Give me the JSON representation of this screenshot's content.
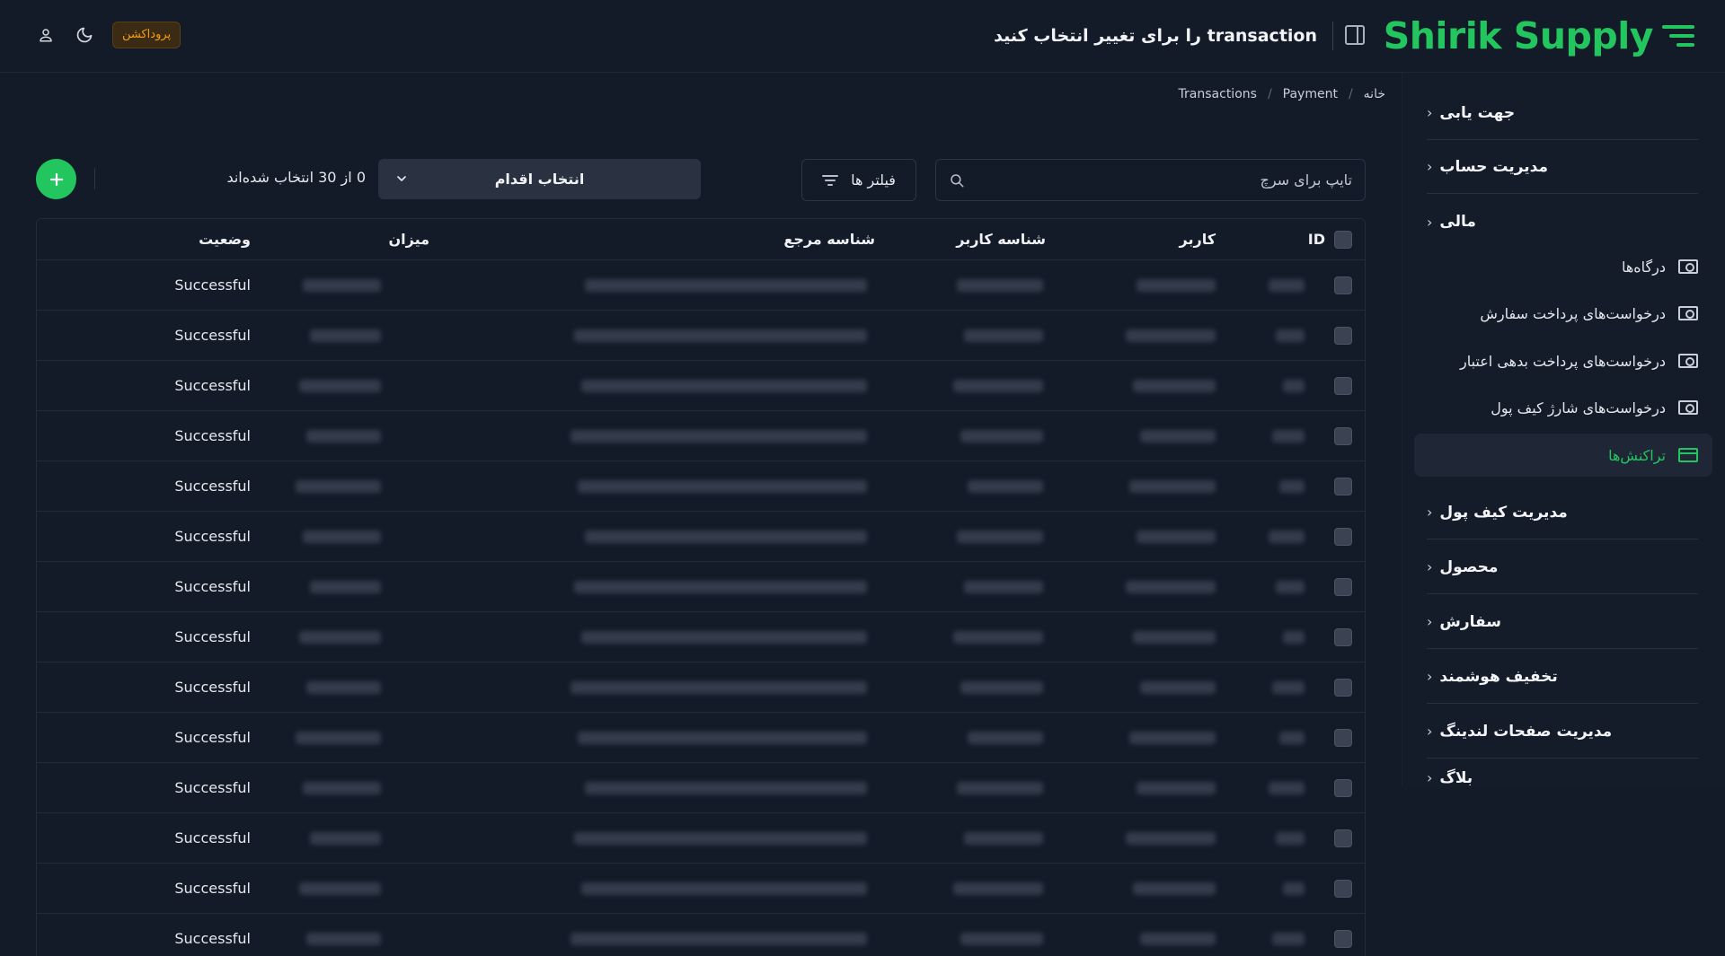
{
  "brand": {
    "name": "Shirik Supply"
  },
  "header": {
    "title": "transaction را برای تغییر انتخاب کنید",
    "env_badge": "پروداکشن"
  },
  "breadcrumb": [
    "خانه",
    "Payment",
    "Transactions"
  ],
  "sidebar": {
    "groups": [
      {
        "label": "جهت یابی"
      },
      {
        "label": "مدیریت حساب"
      },
      {
        "label": "مالی"
      },
      {
        "label": "مدیریت کیف پول"
      },
      {
        "label": "محصول"
      },
      {
        "label": "سفارش"
      },
      {
        "label": "تخفیف هوشمند"
      },
      {
        "label": "مدیریت صفحات لندینگ"
      },
      {
        "label": "بلاگ"
      }
    ],
    "finance_items": [
      {
        "label": "درگاه‌ها",
        "icon": "cash-icon"
      },
      {
        "label": "درخواست‌های پرداخت سفارش",
        "icon": "cash-icon"
      },
      {
        "label": "درخواست‌های پرداخت بدهی اعتبار",
        "icon": "cash-icon"
      },
      {
        "label": "درخواست‌های شارژ کیف پول",
        "icon": "cash-icon"
      },
      {
        "label": "تراکنش‌ها",
        "icon": "credit-card-icon",
        "active": true
      }
    ]
  },
  "toolbar": {
    "search_placeholder": "تایپ برای سرچ",
    "filter_label": "فیلتر ها",
    "action_label": "انتخاب اقدام",
    "selected_text": "0 از 30 انتخاب شده‌اند"
  },
  "table": {
    "headers": {
      "id": "ID",
      "user": "کاربر",
      "user_id": "شناسه کاربر",
      "reference_id": "شناسه مرجع",
      "amount": "میزان",
      "status": "وضعیت"
    },
    "rows": [
      {
        "status": "Successful"
      },
      {
        "status": "Successful"
      },
      {
        "status": "Successful"
      },
      {
        "status": "Successful"
      },
      {
        "status": "Successful"
      },
      {
        "status": "Successful"
      },
      {
        "status": "Successful"
      },
      {
        "status": "Successful"
      },
      {
        "status": "Successful"
      },
      {
        "status": "Successful"
      },
      {
        "status": "Successful"
      },
      {
        "status": "Successful"
      },
      {
        "status": "Successful"
      },
      {
        "status": "Successful"
      }
    ]
  },
  "colors": {
    "accent": "#22c55e",
    "badge_text": "#f59e0b",
    "background": "#131a28"
  }
}
